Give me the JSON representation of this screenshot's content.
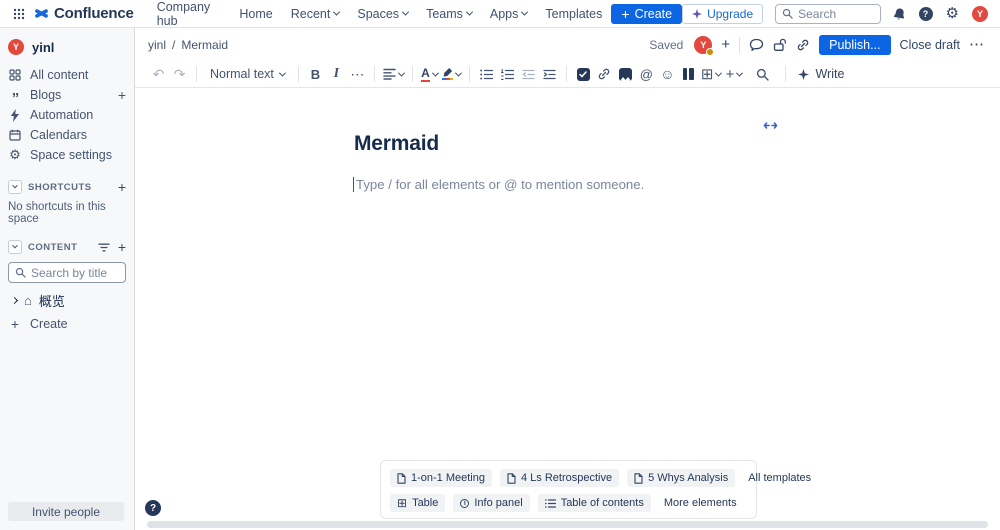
{
  "topnav": {
    "logo": "Confluence",
    "items": [
      {
        "label": "Company hub"
      },
      {
        "label": "Home"
      },
      {
        "label": "Recent"
      },
      {
        "label": "Spaces"
      },
      {
        "label": "Teams"
      },
      {
        "label": "Apps"
      },
      {
        "label": "Templates"
      }
    ],
    "create_label": "Create",
    "upgrade_label": "Upgrade",
    "search_placeholder": "Search",
    "avatar_initial": "Y"
  },
  "page_header": {
    "breadcrumb_space": "yinl",
    "separator": "/",
    "breadcrumb_page": "Mermaid",
    "saved_label": "Saved",
    "avatar_initial": "Y",
    "publish_label": "Publish...",
    "close_draft_label": "Close draft"
  },
  "toolbar": {
    "text_style": "Normal text",
    "bold": "B",
    "italic": "I",
    "color_letter": "A",
    "at": "@",
    "emoji": "☺",
    "table": "⊞",
    "plus": "+",
    "more": "⋯",
    "undo": "↶",
    "redo": "↷",
    "write_label": "Write"
  },
  "sidebar": {
    "space_name": "yinl",
    "space_initial": "Y",
    "items": [
      {
        "label": "All content"
      },
      {
        "label": "Blogs"
      },
      {
        "label": "Automation"
      },
      {
        "label": "Calendars"
      },
      {
        "label": "Space settings"
      }
    ],
    "shortcuts_title": "SHORTCUTS",
    "shortcuts_empty": "No shortcuts in this space",
    "content_title": "CONTENT",
    "search_placeholder": "Search by title",
    "page_item": "概览",
    "create_label": "Create",
    "invite_label": "Invite people",
    "home_glyph": "⌂",
    "gear_glyph": "⚙",
    "quote_glyph": "”"
  },
  "editor": {
    "title": "Mermaid",
    "placeholder": "Type / for all elements or @ to mention someone."
  },
  "templates_panel": {
    "suggestions": [
      {
        "label": "1-on-1 Meeting"
      },
      {
        "label": "4 Ls Retrospective"
      },
      {
        "label": "5 Whys Analysis"
      }
    ],
    "all_templates_label": "All templates",
    "elements": [
      {
        "label": "Table"
      },
      {
        "label": "Info panel"
      },
      {
        "label": "Table of contents"
      }
    ],
    "more_elements_label": "More elements",
    "table_glyph": "⊞",
    "info_glyph": "i"
  },
  "misc": {
    "help_glyph": "?",
    "question_glyph": "?",
    "plus_glyph": "+",
    "gear_glyph": "⚙"
  },
  "colors": {
    "primary_blue": "#0C66E4",
    "link_blue": "#1868DB",
    "text_dark": "#172B4D",
    "icon_gray": "#44546F",
    "muted_gray": "#626F86",
    "border": "#DCDFE4",
    "sidebar_bg": "#F7F8F9",
    "avatar_red": "#E2483D",
    "upgrade_sparkle": "#6554C0"
  }
}
